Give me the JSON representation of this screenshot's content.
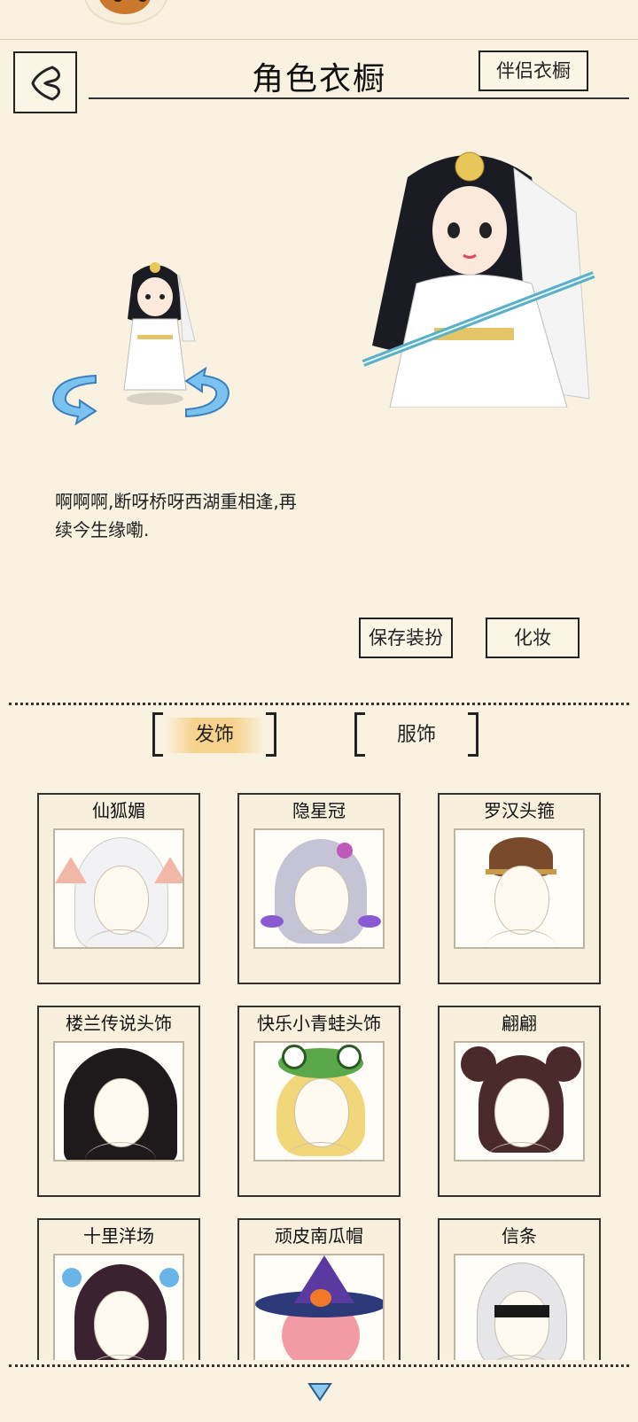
{
  "header": {
    "title": "角色衣橱",
    "companion_label": "伴侣衣橱"
  },
  "character": {
    "quote": "啊啊啊,断呀桥呀西湖重相逢,再续今生缘嘞."
  },
  "actions": {
    "save_label": "保存装扮",
    "makeup_label": "化妆"
  },
  "tabs": [
    {
      "label": "发饰",
      "active": true
    },
    {
      "label": "服饰",
      "active": false
    }
  ],
  "items": [
    {
      "name": "仙狐媚",
      "hair_color": "#f2f2f4"
    },
    {
      "name": "隐星冠",
      "hair_color": "#c4c4d6"
    },
    {
      "name": "罗汉头箍",
      "hair_color": "#7a4a2c"
    },
    {
      "name": "楼兰传说头饰",
      "hair_color": "#1e1a1c"
    },
    {
      "name": "快乐小青蛙头饰",
      "hair_color": "#f1d77a"
    },
    {
      "name": "翩翩",
      "hair_color": "#4a2a2a"
    },
    {
      "name": "十里洋场",
      "hair_color": "#3a2230"
    },
    {
      "name": "顽皮南瓜帽",
      "hair_color": "#f29aa6"
    },
    {
      "name": "信条",
      "hair_color": "#e6e6e8"
    }
  ],
  "colors": {
    "background": "#faf2e0",
    "tab_highlight": "#f6d28c",
    "arrow_blue": "#6ab4e8"
  }
}
